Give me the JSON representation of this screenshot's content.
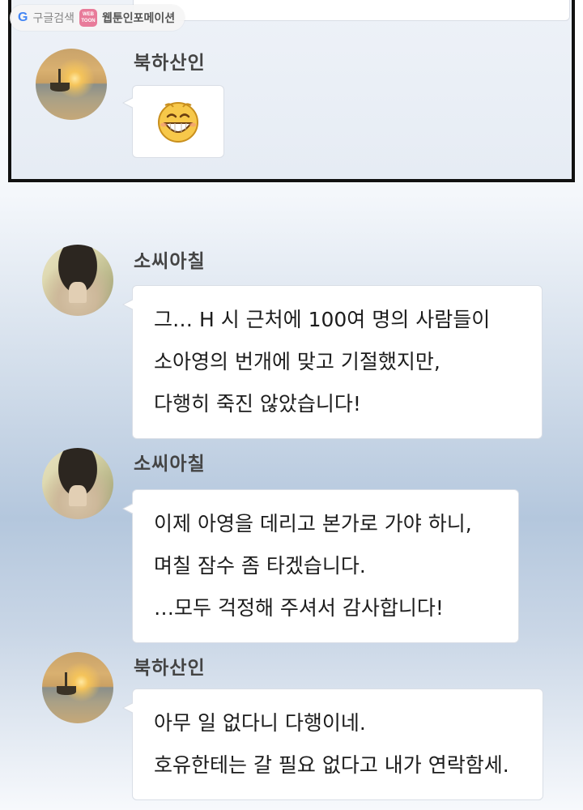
{
  "watermark": {
    "google_letter": "G",
    "search_label": "구글검색",
    "webtoon_badge_top": "WEB",
    "webtoon_badge_bottom": "TOON",
    "site_name": "웹툰인포메이션"
  },
  "messages": [
    {
      "speaker": "북하산인",
      "avatar": "sunset-boat-avatar",
      "emoji": "grinning-face-icon"
    },
    {
      "speaker": "소씨아칠",
      "avatar": "hat-covered-face-avatar",
      "lines": [
        "그… H 시 근처에 100여 명의 사람들이",
        "소아영의 번개에 맞고 기절했지만,",
        "다행히 죽진 않았습니다!"
      ]
    },
    {
      "speaker": "소씨아칠",
      "avatar": "hat-covered-face-avatar",
      "lines": [
        "이제 아영을 데리고 본가로 가야 하니,",
        "며칠 잠수 좀 타겠습니다.",
        "…모두 걱정해 주셔서 감사합니다!"
      ]
    },
    {
      "speaker": "북하산인",
      "avatar": "sunset-boat-avatar",
      "lines": [
        "아무 일 없다니 다행이네.",
        "호유한테는 갈 필요 없다고 내가 연락함세."
      ]
    }
  ],
  "colors": {
    "bubble_border": "#d9dee6",
    "frame_border": "#111111",
    "emoji_yellow": "#f7c84a"
  }
}
